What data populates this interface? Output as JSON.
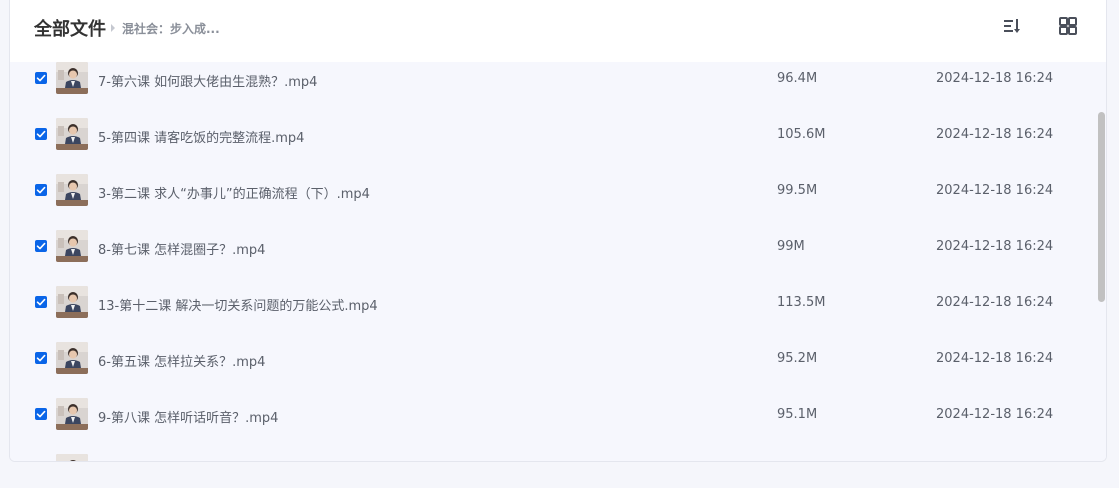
{
  "header": {
    "title": "全部文件",
    "breadcrumb": "混社会：步入成...",
    "sort_icon": "sort-list-icon",
    "grid_icon": "grid-view-icon"
  },
  "files": [
    {
      "name": "7-第六课 如何跟大佬由生混熟？.mp4",
      "size": "96.4M",
      "date": "2024-12-18 16:24",
      "checked": true
    },
    {
      "name": "5-第四课 请客吃饭的完整流程.mp4",
      "size": "105.6M",
      "date": "2024-12-18 16:24",
      "checked": true
    },
    {
      "name": "3-第二课 求人“办事儿”的正确流程（下）.mp4",
      "size": "99.5M",
      "date": "2024-12-18 16:24",
      "checked": true
    },
    {
      "name": "8-第七课 怎样混圈子？.mp4",
      "size": "99M",
      "date": "2024-12-18 16:24",
      "checked": true
    },
    {
      "name": "13-第十二课 解决一切关系问题的万能公式.mp4",
      "size": "113.5M",
      "date": "2024-12-18 16:24",
      "checked": true
    },
    {
      "name": "6-第五课 怎样拉关系？.mp4",
      "size": "95.2M",
      "date": "2024-12-18 16:24",
      "checked": true
    },
    {
      "name": "9-第八课 怎样听话听音？.mp4",
      "size": "95.1M",
      "date": "2024-12-18 16:24",
      "checked": true
    }
  ],
  "colors": {
    "checkbox": "#0a65e8",
    "list_bg": "#f6f7fd",
    "text": "#5b606b"
  }
}
